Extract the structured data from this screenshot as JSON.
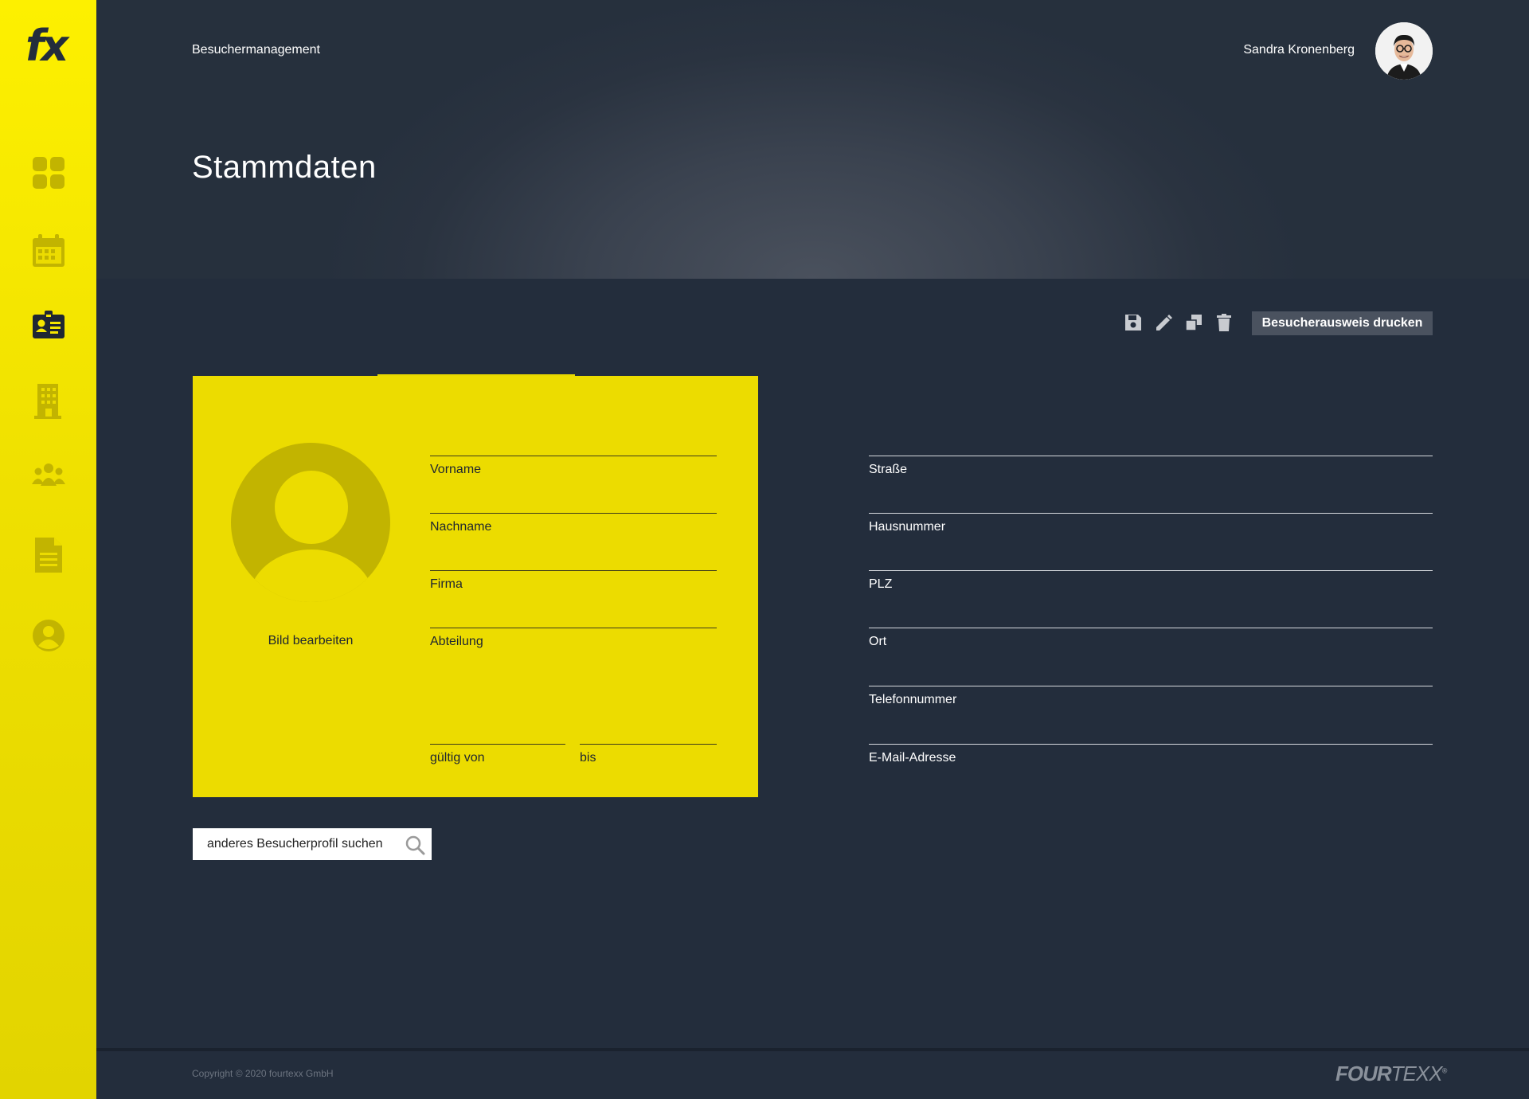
{
  "app": {
    "logo_text": "fx"
  },
  "sidebar": {
    "items": [
      {
        "icon": "dashboard-grid-icon"
      },
      {
        "icon": "calendar-icon"
      },
      {
        "icon": "id-card-icon",
        "active": true
      },
      {
        "icon": "building-icon"
      },
      {
        "icon": "people-group-icon"
      },
      {
        "icon": "document-icon"
      },
      {
        "icon": "user-profile-icon"
      }
    ]
  },
  "header": {
    "breadcrumb": "Besuchermanagement",
    "user_name": "Sandra Kronenberg"
  },
  "page": {
    "title": "Stammdaten"
  },
  "toolbar": {
    "icons": [
      "save-icon",
      "edit-pencil-icon",
      "duplicate-icon",
      "delete-trash-icon"
    ],
    "print_label": "Besucherausweis drucken"
  },
  "badge": {
    "edit_photo_label": "Bild bearbeiten",
    "fields": {
      "vorname": "Vorname",
      "nachname": "Nachname",
      "firma": "Firma",
      "abteilung": "Abteilung",
      "gueltig_von": "gültig von",
      "bis": "bis"
    }
  },
  "address": {
    "fields": {
      "strasse": "Straße",
      "hausnummer": "Hausnummer",
      "plz": "PLZ",
      "ort": "Ort",
      "telefon": "Telefonnummer",
      "email": "E-Mail-Adresse"
    }
  },
  "search": {
    "placeholder": "anderes Besucherprofil suchen"
  },
  "footer": {
    "copyright": "Copyright © 2020 fourtexx GmbH",
    "brand_bold": "FOUR",
    "brand_light": "TEXX",
    "brand_mark": "®"
  },
  "colors": {
    "sidebar_yellow": "#f5e600",
    "card_yellow": "#ecdc00",
    "background": "#232d3c",
    "accent_button": "#4a525f"
  }
}
